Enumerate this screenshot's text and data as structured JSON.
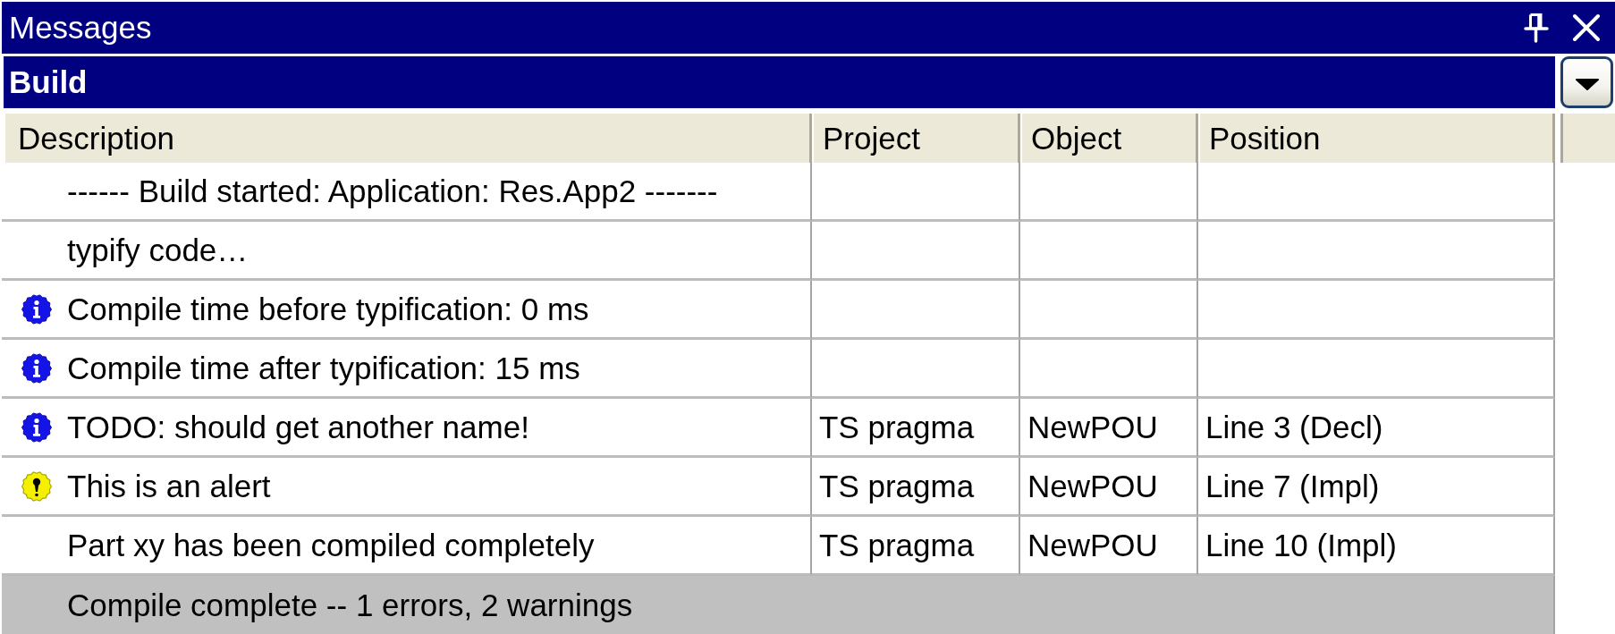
{
  "window": {
    "title": "Messages"
  },
  "category_selector": {
    "value": "Build"
  },
  "table": {
    "columns": [
      "Description",
      "Project",
      "Object",
      "Position"
    ],
    "rows": [
      {
        "kind": "plain",
        "description": "------ Build started: Application: Res.App2 -------"
      },
      {
        "kind": "plain",
        "description": "typify code…"
      },
      {
        "kind": "info",
        "description": "Compile time before typification: 0 ms"
      },
      {
        "kind": "info",
        "description": "Compile time after typification: 15 ms"
      },
      {
        "kind": "info",
        "description": "TODO: should get another name!",
        "project": "TS pragma",
        "object": "NewPOU",
        "position": "Line 3 (Decl)"
      },
      {
        "kind": "alert",
        "description": "This is an alert",
        "project": "TS pragma",
        "object": "NewPOU",
        "position": "Line 7 (Impl)"
      },
      {
        "kind": "plain",
        "description": "Part xy has been compiled completely",
        "project": "TS pragma",
        "object": "NewPOU",
        "position": "Line 10 (Impl)"
      }
    ],
    "summary": "Compile complete -- 1 errors, 2 warnings"
  }
}
